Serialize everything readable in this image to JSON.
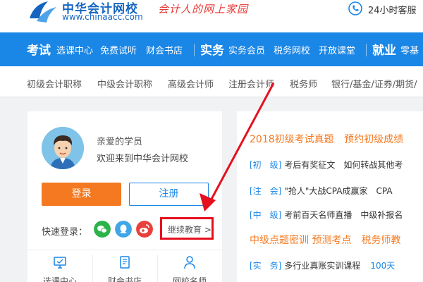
{
  "header": {
    "logo_cn": "中华会计网校",
    "logo_url": "www.chinaacc.com",
    "slogan": "会计人的网上家园",
    "service": "24小时客服"
  },
  "main_nav": {
    "exam": "考试",
    "exam_items": [
      "选课中心",
      "免费试听",
      "财会书店"
    ],
    "practice": "实务",
    "practice_items": [
      "实务会员",
      "税务网校",
      "开放课堂"
    ],
    "job": "就业",
    "job_items": [
      "零基"
    ]
  },
  "sub_nav": [
    "初级会计职称",
    "中级会计职称",
    "高级会计师",
    "注册会计师",
    "税务师",
    "银行/基金/证券/期货/"
  ],
  "user_panel": {
    "greeting": "亲爱的学员",
    "welcome": "欢迎来到中华会计网校",
    "login_label": "登录",
    "register_label": "注册",
    "quick_login_label": "快速登录：",
    "continue_edu": "继续教育 >",
    "tools": [
      "选课中心",
      "财会书店",
      "网校名师"
    ]
  },
  "news": {
    "headline1_a": "2018初级考试真题",
    "headline1_b": "预约初级成绩",
    "rows": [
      {
        "tag": "[初　级]",
        "text": "考后有奖征文　如何转战其他考"
      },
      {
        "tag": "[注　会]",
        "text": "\"抢人\"大战CPA成赢家　CPA"
      },
      {
        "tag": "[中　级]",
        "text": "考前百天名师直播　中级补报名"
      }
    ],
    "headline2": "中级点题密训 预测考点　税务师教",
    "row4_tag": "[实　务]",
    "row4_text": "多行业真账实训课程",
    "row4_extra": "100天"
  },
  "colors": {
    "brand_blue": "#1a86e6",
    "orange": "#f47920",
    "annotation_red": "#e5101e"
  }
}
